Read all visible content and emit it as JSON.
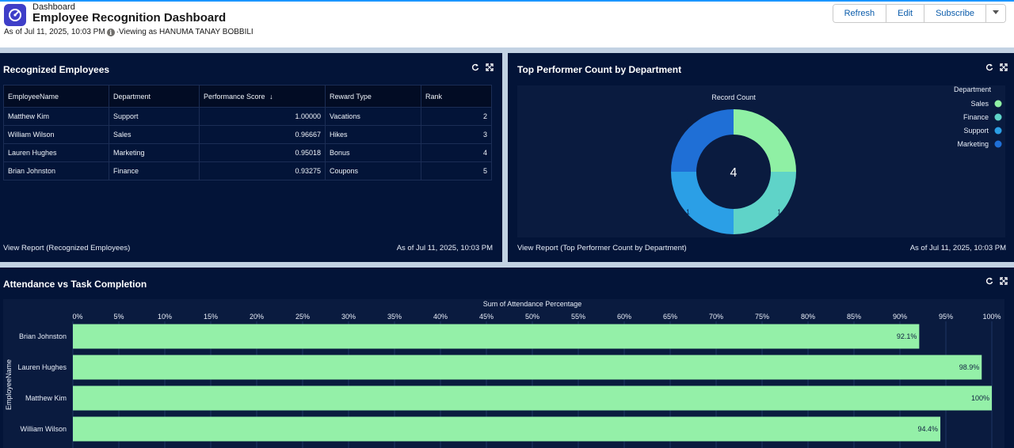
{
  "header": {
    "breadcrumb": "Dashboard",
    "title": "Employee Recognition Dashboard",
    "as_of": "As of Jul 11, 2025, 10:03 PM",
    "viewing": "·Viewing as HANUMA TANAY BOBBILI",
    "buttons": {
      "refresh": "Refresh",
      "edit": "Edit",
      "subscribe": "Subscribe"
    }
  },
  "recognized": {
    "title": "Recognized Employees",
    "columns": [
      "EmployeeName",
      "Department",
      "Performance Score",
      "Reward Type",
      "Rank"
    ],
    "sort_indicator": "↓",
    "rows": [
      {
        "name": "Matthew Kim",
        "department": "Support",
        "score": "1.00000",
        "reward": "Vacations",
        "rank": "2"
      },
      {
        "name": "William Wilson",
        "department": "Sales",
        "score": "0.96667",
        "reward": "Hikes",
        "rank": "3"
      },
      {
        "name": "Lauren Hughes",
        "department": "Marketing",
        "score": "0.95018",
        "reward": "Bonus",
        "rank": "4"
      },
      {
        "name": "Brian Johnston",
        "department": "Finance",
        "score": "0.93275",
        "reward": "Coupons",
        "rank": "5"
      }
    ],
    "footer_link": "View Report (Recognized Employees)",
    "footer_time": "As of Jul 11, 2025, 10:03 PM"
  },
  "topPerformer": {
    "title": "Top Performer Count by Department",
    "footer_link": "View Report (Top Performer Count by Department)",
    "footer_time": "As of Jul 11, 2025, 10:03 PM"
  },
  "attendance": {
    "title": "Attendance vs Task Completion"
  },
  "colors": {
    "sales": "#8ff0a4",
    "finance": "#5fd3c8",
    "support": "#2b9fe6",
    "marketing": "#1f6fd6",
    "bar": "#94f0a8"
  },
  "chart_data": [
    {
      "type": "pie",
      "title": "Record Count",
      "legend_title": "Department",
      "legend_position": "top-right",
      "center_label": "4",
      "categories": [
        "Sales",
        "Finance",
        "Support",
        "Marketing"
      ],
      "values": [
        1,
        1,
        1,
        1
      ]
    },
    {
      "type": "bar",
      "orientation": "horizontal",
      "title": "Sum of Attendance Percentage",
      "ylabel": "EmployeeName",
      "categories": [
        "Brian Johnston",
        "Lauren Hughes",
        "Matthew Kim",
        "William Wilson"
      ],
      "values": [
        92.1,
        98.9,
        100,
        94.4
      ],
      "value_labels": [
        "92.1%",
        "98.9%",
        "100%",
        "94.4%"
      ],
      "xlim": [
        0,
        100
      ],
      "ticks": [
        "0%",
        "5%",
        "10%",
        "15%",
        "20%",
        "25%",
        "30%",
        "35%",
        "40%",
        "45%",
        "50%",
        "55%",
        "60%",
        "65%",
        "70%",
        "75%",
        "80%",
        "85%",
        "90%",
        "95%",
        "100%"
      ],
      "grid": true
    }
  ]
}
